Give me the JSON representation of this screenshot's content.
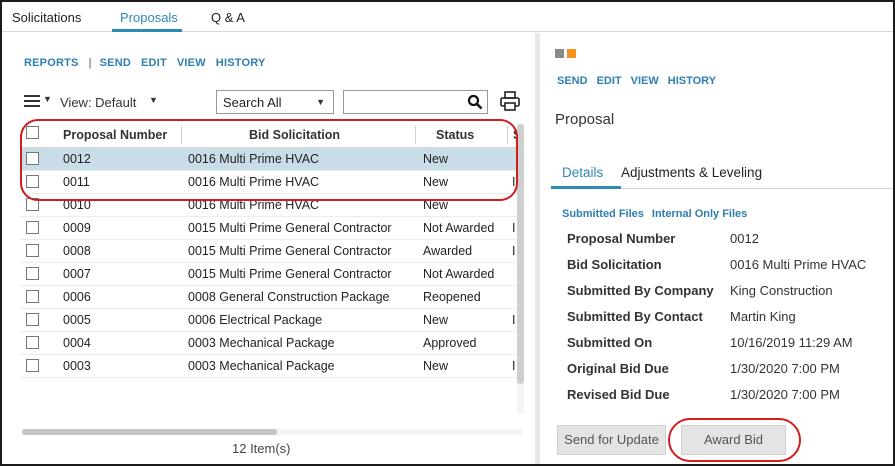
{
  "top_tabs": [
    "Solicitations",
    "Proposals",
    "Q & A"
  ],
  "left_actions": {
    "reports": "REPORTS",
    "sep": "|",
    "send": "SEND",
    "edit": "EDIT",
    "view": "VIEW",
    "history": "HISTORY"
  },
  "toolbar": {
    "view_label": "View: Default",
    "search_select": "Search All",
    "search_value": ""
  },
  "table": {
    "headers": [
      "Proposal Number",
      "Bid Solicitation",
      "Status",
      "S"
    ],
    "rows": [
      {
        "number": "0012",
        "solicitation": "0016 Multi Prime HVAC",
        "status": "New",
        "extra": ""
      },
      {
        "number": "0011",
        "solicitation": "0016 Multi Prime HVAC",
        "status": "New",
        "extra": "I"
      },
      {
        "number": "0010",
        "solicitation": "0016 Multi Prime HVAC",
        "status": "New",
        "extra": ""
      },
      {
        "number": "0009",
        "solicitation": "0015 Multi Prime General Contractor",
        "status": "Not Awarded",
        "extra": "I"
      },
      {
        "number": "0008",
        "solicitation": "0015 Multi Prime General Contractor",
        "status": "Awarded",
        "extra": "I"
      },
      {
        "number": "0007",
        "solicitation": "0015 Multi Prime General Contractor",
        "status": "Not Awarded",
        "extra": ""
      },
      {
        "number": "0006",
        "solicitation": "0008 General Construction Package",
        "status": "Reopened",
        "extra": ""
      },
      {
        "number": "0005",
        "solicitation": "0006 Electrical Package",
        "status": "New",
        "extra": "I"
      },
      {
        "number": "0004",
        "solicitation": "0003 Mechanical Package",
        "status": "Approved",
        "extra": ""
      },
      {
        "number": "0003",
        "solicitation": "0003 Mechanical Package",
        "status": "New",
        "extra": "I"
      }
    ],
    "item_count": "12 Item(s)"
  },
  "right": {
    "actions": {
      "send": "SEND",
      "edit": "EDIT",
      "view": "VIEW",
      "history": "HISTORY"
    },
    "title": "Proposal",
    "tabs": [
      "Details",
      "Adjustments & Leveling"
    ],
    "files_links": [
      "Submitted Files",
      "Internal Only Files"
    ],
    "details": [
      {
        "label": "Proposal Number",
        "value": "0012"
      },
      {
        "label": "Bid Solicitation",
        "value": "0016 Multi Prime HVAC"
      },
      {
        "label": "Submitted By Company",
        "value": "King Construction"
      },
      {
        "label": "Submitted By Contact",
        "value": "Martin King"
      },
      {
        "label": "Submitted On",
        "value": "10/16/2019 11:29 AM"
      },
      {
        "label": "Original Bid Due",
        "value": "1/30/2020 7:00 PM"
      },
      {
        "label": "Revised Bid Due",
        "value": "1/30/2020 7:00 PM"
      }
    ],
    "buttons": {
      "send_for_update": "Send for Update",
      "award_bid": "Award Bid"
    }
  },
  "colors": {
    "accent": "#2e89b3",
    "link": "#2e7fb0",
    "highlight": "#d11d1d",
    "selected_row": "#c9dde8",
    "square_gray": "#8a8a8a",
    "square_orange": "#f5921e"
  }
}
